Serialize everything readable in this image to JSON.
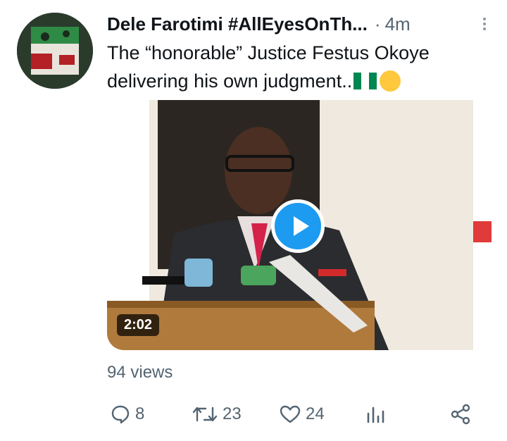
{
  "tweet": {
    "author_name": "Dele Farotimi #AllEyesOnTh...",
    "separator": "·",
    "time_ago": "4m",
    "text": "The “honorable” Justice Festus Okoye delivering his own judgment..",
    "video_duration": "2:02",
    "views": "94 views"
  },
  "actions": {
    "reply_count": "8",
    "retweet_count": "23",
    "like_count": "24"
  },
  "icons": {
    "avatar": "avatar",
    "more": "more-vertical-icon",
    "flag": "nigeria-flag-emoji",
    "emoji": "yawning-face-emoji",
    "play": "play-icon",
    "reply": "reply-icon",
    "retweet": "retweet-icon",
    "like": "heart-icon",
    "analytics": "analytics-icon",
    "share": "share-icon"
  },
  "colors": {
    "accent": "#1d9bf0",
    "secondary_text": "#536471",
    "flag_green": "#008751"
  }
}
